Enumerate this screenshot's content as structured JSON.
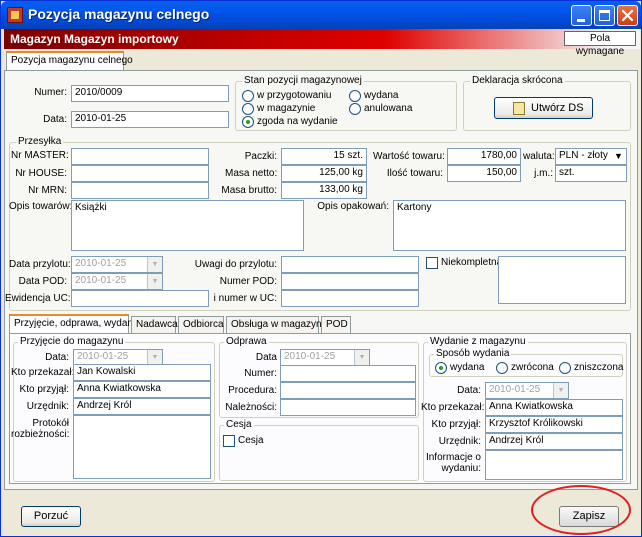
{
  "window": {
    "title": "Pozycja magazynu celnego"
  },
  "header": {
    "title": "Magazyn Magazyn importowy",
    "required_button": "Pola wymagane"
  },
  "main_tab": {
    "label": "Pozycja magazynu celnego"
  },
  "top": {
    "numer_label": "Numer:",
    "numer_value": "2010/0009",
    "data_label": "Data:",
    "data_value": "2010-01-25"
  },
  "stan": {
    "legend": "Stan pozycji magazynowej",
    "options": [
      {
        "label": "w przygotowaniu",
        "selected": false
      },
      {
        "label": "w magazynie",
        "selected": false
      },
      {
        "label": "zgoda na wydanie",
        "selected": true
      },
      {
        "label": "wydana",
        "selected": false
      },
      {
        "label": "anulowana",
        "selected": false
      }
    ]
  },
  "deklaracja": {
    "legend": "Deklaracja skrócona",
    "button": "Utwórz DS"
  },
  "przesylka": {
    "legend": "Przesyłka",
    "master_label": "Nr MASTER:",
    "master_value": "",
    "house_label": "Nr HOUSE:",
    "house_value": "",
    "mrn_label": "Nr MRN:",
    "mrn_value": "",
    "paczki_label": "Paczki:",
    "paczki_value": "15 szt.",
    "masa_netto_label": "Masa netto:",
    "masa_netto_value": "125,00 kg",
    "masa_brutto_label": "Masa brutto:",
    "masa_brutto_value": "133,00 kg",
    "wartosc_label": "Wartość towaru:",
    "wartosc_value": "1780,00",
    "ilosc_label": "Ilość towaru:",
    "ilosc_value": "150,00",
    "waluta_label": "waluta:",
    "waluta_value": "PLN - złoty",
    "jm_label": "j.m.:",
    "jm_value": "szt.",
    "opis_tow_label": "Opis towarów:",
    "opis_tow_value": "Książki",
    "opis_opak_label": "Opis opakowań:",
    "opis_opak_value": "Kartony",
    "data_przylotu_label": "Data przylotu:",
    "data_przylotu_value": "2010-01-25",
    "data_pod_label": "Data POD:",
    "data_pod_value": "2010-01-25",
    "ewidencja_label": "Ewidencja UC:",
    "ewidencja_value": "",
    "uwagi_label": "Uwagi do przylotu:",
    "uwagi_value": "",
    "numer_pod_label": "Numer POD:",
    "numer_pod_value": "",
    "inumer_label": "i numer w UC:",
    "inumer_value": "",
    "niekompletna_label": "Niekompletna"
  },
  "sub_tabs": [
    {
      "label": "Przyjęcie, odprawa, wydanie",
      "active": true
    },
    {
      "label": "Nadawca",
      "active": false
    },
    {
      "label": "Odbiorca",
      "active": false
    },
    {
      "label": "Obsługa w magazynie",
      "active": false
    },
    {
      "label": "POD",
      "active": false
    }
  ],
  "przyjecie": {
    "legend": "Przyjęcie do magazynu",
    "data_label": "Data:",
    "data_value": "2010-01-25",
    "kto_przekazal_label": "Kto przekazał:",
    "kto_przekazal_value": "Jan Kowalski",
    "kto_przyjal_label": "Kto przyjął:",
    "kto_przyjal_value": "Anna Kwiatkowska",
    "urzednik_label": "Urzędnik:",
    "urzednik_value": "Andrzej Król",
    "protokol_label1": "Protokół",
    "protokol_label2": "rozbieżności:",
    "protokol_value": ""
  },
  "odprawa": {
    "legend": "Odprawa",
    "data_label": "Data",
    "data_value": "2010-01-25",
    "numer_label": "Numer:",
    "numer_value": "",
    "procedura_label": "Procedura:",
    "procedura_value": "",
    "naleznosci_label": "Należności:",
    "naleznosci_value": ""
  },
  "cesja": {
    "legend": "Cesja",
    "checkbox_label": "Cesja"
  },
  "wydanie": {
    "legend": "Wydanie z magazynu",
    "sposob_legend": "Sposób wydania",
    "options": [
      {
        "label": "wydana",
        "selected": true
      },
      {
        "label": "zwrócona",
        "selected": false
      },
      {
        "label": "zniszczona",
        "selected": false
      }
    ],
    "data_label": "Data:",
    "data_value": "2010-01-25",
    "kto_przekazal_label": "Kto przekazał:",
    "kto_przekazal_value": "Anna Kwiatkowska",
    "kto_przyjal_label": "Kto przyjął:",
    "kto_przyjal_value": "Krzysztof Królikowski",
    "urzednik_label": "Urzędnik:",
    "urzednik_value": "Andrzej Król",
    "info_label1": "Informacje o",
    "info_label2": "wydaniu:",
    "info_value": ""
  },
  "footer": {
    "cancel_button": "Porzuć",
    "save_button": "Zapisz"
  }
}
